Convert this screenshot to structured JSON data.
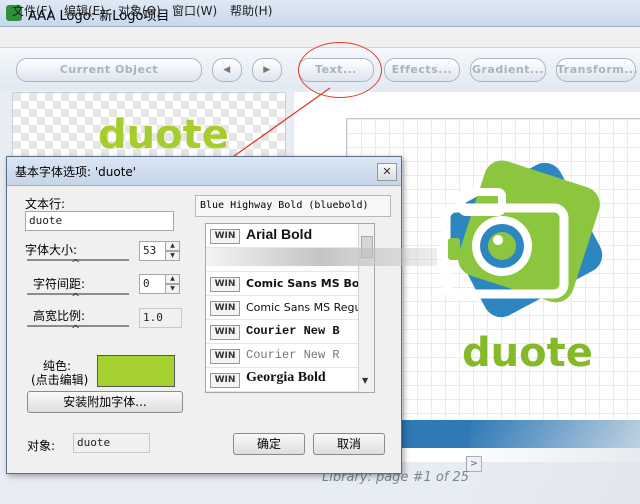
{
  "window": {
    "title": "AAA Logo: 新Logo项目"
  },
  "menu": [
    "文件(F)",
    "编辑(E)",
    "对象(O)",
    "窗口(W)",
    "帮助(H)"
  ],
  "toolbar": {
    "current_object": "Current Object",
    "prev": "◀",
    "next": "▶",
    "text": "Text...",
    "effects": "Effects...",
    "gradient": "Gradient...",
    "transform": "Transform..."
  },
  "preview": {
    "text": "duote"
  },
  "logo": {
    "text": "duote",
    "colors": {
      "green": "#8cc63f",
      "blue": "#2e86c1",
      "frame": "#ffffff"
    }
  },
  "library": {
    "text": "Library: page #1 of 25"
  },
  "dialog": {
    "title": "基本字体选项: 'duote'",
    "text_line_label": "文本行:",
    "text_line_value": "duote",
    "font_size_label": "字体大小:",
    "font_size_value": "53",
    "char_spacing_label": "字符间距:",
    "char_spacing_value": "0",
    "aspect_label": "高宽比例:",
    "aspect_value": "1.0",
    "color_label_1": "纯色:",
    "color_label_2": "(点击编辑)",
    "swatch_color": "#a4d12f",
    "install_fonts": "安装附加字体...",
    "object_label": "对象:",
    "object_value": "duote",
    "ok": "确定",
    "cancel": "取消",
    "current_font": "Blue Highway Bold (bluebold)",
    "fonts": [
      {
        "badge": "WIN",
        "name": "Arial Bold"
      },
      {
        "badge": "",
        "name": ""
      },
      {
        "badge": "WIN",
        "name": "Comic Sans MS Bo"
      },
      {
        "badge": "WIN",
        "name": "Comic Sans MS Regu"
      },
      {
        "badge": "WIN",
        "name": "Courier New B"
      },
      {
        "badge": "WIN",
        "name": "Courier New R"
      },
      {
        "badge": "WIN",
        "name": "Georgia Bold"
      }
    ]
  }
}
